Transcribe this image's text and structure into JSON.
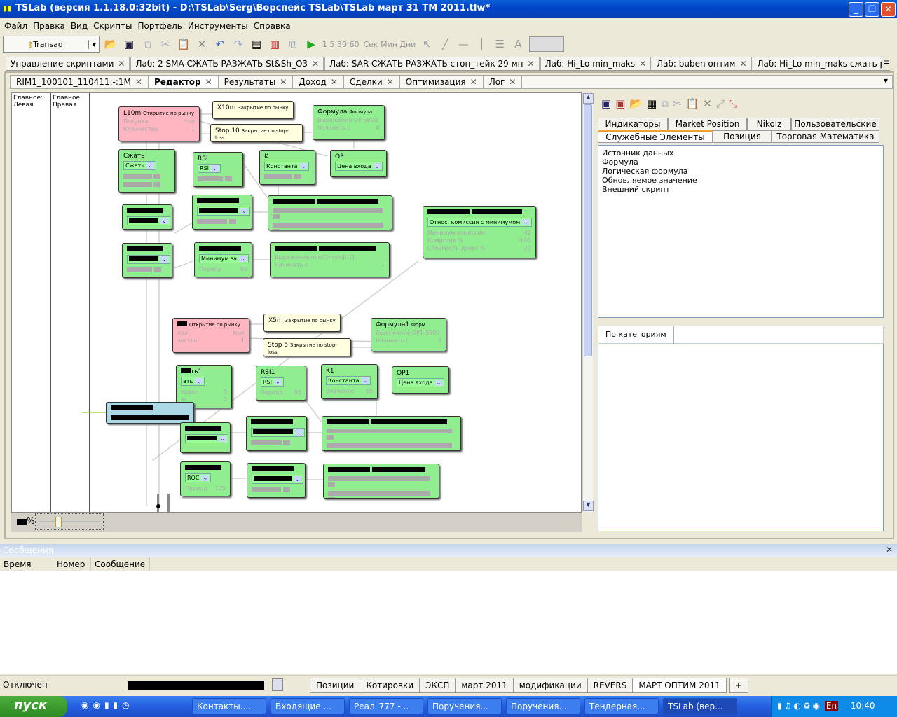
{
  "window": {
    "title": "TSLab (версия 1.1.18.0:32bit) - D:\\TSLab\\Serg\\Ворспейс TSLab\\TSLab март 31  TM 2011.tlw*"
  },
  "menu": [
    "Файл",
    "Правка",
    "Вид",
    "Скрипты",
    "Портфель",
    "Инструменты",
    "Справка"
  ],
  "toolbar": {
    "connector": "Transaq",
    "timeframes": "1 5 30 60",
    "units": "Сек Мин Дни"
  },
  "doc_tabs": [
    "Управление скриптами",
    "Лаб: 2 SMA СЖАТЬ РАЗЖАТЬ St&Sh_O3",
    "Лаб: SAR  СЖАТЬ РАЗЖАТЬ стоп_тейк 29 мн",
    "Лаб: Hi_Lo min_maks",
    "Лаб: buben оптим",
    "Лаб: Hi_Lo min_maks сжать разжать2-29"
  ],
  "sub_tabs": [
    "RIM1_100101_110411:-:1M",
    "Редактор",
    "Результаты",
    "Доход",
    "Сделки",
    "Оптимизация",
    "Лог"
  ],
  "active_sub_tab": "Редактор",
  "lanes": [
    {
      "line1": "Главное:",
      "line2": "Левая"
    },
    {
      "line1": "Главное:",
      "line2": "Правая"
    }
  ],
  "nodes": [
    {
      "style": "p",
      "title": "L10m",
      "sub": "Открытие по рынку",
      "fields": [
        [
          "Покупка",
          "true"
        ],
        [
          "Количество",
          "1"
        ]
      ]
    },
    {
      "style": "y",
      "title": "X10m",
      "sub": "Закрытие по рынку"
    },
    {
      "style": "y",
      "title": "Stop 10",
      "sub": "Закрытие по stop-loss"
    },
    {
      "style": "g",
      "title": "Формула",
      "sub": "Формула",
      "fields": [
        [
          "Выражение OP-5000",
          ""
        ],
        [
          "Начинать с",
          "0"
        ]
      ]
    },
    {
      "style": "g",
      "title": "Сжать",
      "select": "Сжать",
      "bars": 2
    },
    {
      "style": "g",
      "title": "RSI",
      "select": "RSI",
      "bars": 1
    },
    {
      "style": "g",
      "title": "K",
      "select": "Константа",
      "bars": 1
    },
    {
      "style": "g",
      "title": "OP",
      "select": "Цена входа"
    },
    {
      "style": "g",
      "redacted": true,
      "select": "",
      "selRed": true
    },
    {
      "style": "g",
      "redacted": true,
      "select": "",
      "selRed": true,
      "bars": 1
    },
    {
      "style": "g",
      "redacted": true,
      "bars": 2
    },
    {
      "style": "g",
      "redacted": true,
      "select": "Относ. комиссия с минимумом",
      "fields": [
        [
          "Минимум комиссии",
          "42"
        ],
        [
          "Комиссия %",
          "0.05"
        ],
        [
          "Стоимость денег %",
          "20"
        ]
      ]
    },
    {
      "style": "g",
      "redacted": true,
      "select": "",
      "selRed": true,
      "bars": 1
    },
    {
      "style": "g",
      "redacted": true,
      "select": "Минимум за",
      "fields": [
        [
          "Период",
          "60"
        ]
      ]
    },
    {
      "style": "g",
      "redacted": true,
      "fields": [
        [
          "Выражение min[i]<min[i-1]",
          ""
        ],
        [
          "Начинать с",
          "1"
        ]
      ]
    },
    {
      "style": "p",
      "title": "",
      "sub": "Открытие по рынку",
      "fields": [
        [
          "пка",
          "true"
        ],
        [
          "чество",
          "1"
        ]
      ]
    },
    {
      "style": "y",
      "title": "X5m",
      "sub": "Закрытие по рынку"
    },
    {
      "style": "y",
      "title": "Stop 5",
      "sub": "Закрытие по stop-loss"
    },
    {
      "style": "g",
      "title": "Формула1",
      "sub": "Форм",
      "fields": [
        [
          "Выражение OP1-3900",
          ""
        ],
        [
          "Начинать с",
          "0"
        ]
      ]
    },
    {
      "style": "g",
      "title": "ть1",
      "select": "ать",
      "fields": [
        [
          "ервал",
          "5"
        ],
        [
          "аг",
          "0"
        ]
      ]
    },
    {
      "style": "g",
      "title": "RSI1",
      "select": "RSI",
      "fields": [
        [
          "Период",
          "85"
        ]
      ]
    },
    {
      "style": "g",
      "title": "K1",
      "select": "Константа",
      "fields": [
        [
          "Значение",
          "66"
        ]
      ]
    },
    {
      "style": "g",
      "title": "OP1",
      "select": "Цена входа"
    },
    {
      "style": "b",
      "redacted": true,
      "bars": 0
    },
    {
      "style": "g",
      "redacted": true,
      "select": "",
      "selRed": true
    },
    {
      "style": "g",
      "redacted": true,
      "select": "",
      "selRed": true,
      "bars": 1
    },
    {
      "style": "g",
      "redacted": true,
      "bars": 2
    },
    {
      "style": "g",
      "redacted": true,
      "select": "ROC",
      "fields": [
        [
          "Период",
          "105"
        ]
      ]
    },
    {
      "style": "g",
      "redacted": true,
      "select": "",
      "selRed": true,
      "bars": 1
    },
    {
      "style": "g",
      "redacted": true,
      "bars": 2
    }
  ],
  "zoom": {
    "suffix": "%",
    "slider_level": 0.3
  },
  "right_panel": {
    "tabs_row1": [
      "Индикаторы",
      "Market Position",
      "Nikolz",
      "Пользовательские"
    ],
    "tabs_row2": [
      "Служебные Элементы",
      "Позиция",
      "Торговая Математика"
    ],
    "active_tab": "Служебные Элементы",
    "items": [
      "Источник данных",
      "Формула",
      "Логическая формула",
      "Обновляемое значение",
      "Внешний скрипт"
    ],
    "category_tab": "По категориям"
  },
  "messages": {
    "title": "Сообщения",
    "columns": [
      "Время",
      "Номер",
      "Сообщение"
    ]
  },
  "status": {
    "connection": "Отключен",
    "tabs": [
      "Позиции",
      "Котировки",
      "ЭКСП",
      "март 2011",
      "модификации",
      "REVERS",
      "МАРТ ОПТИМ 2011"
    ],
    "active": "МАРТ ОПТИМ 2011",
    "add": "+"
  },
  "taskbar": {
    "start": "пуск",
    "tasks": [
      "Контакты....",
      "Входящие ...",
      "Реал_777 -...",
      "Поручения...",
      "Поручения...",
      "Тендерная...",
      "TSLab (вер..."
    ],
    "active_task": "TSLab (вер...",
    "lang": "En",
    "clock": "10:40"
  }
}
